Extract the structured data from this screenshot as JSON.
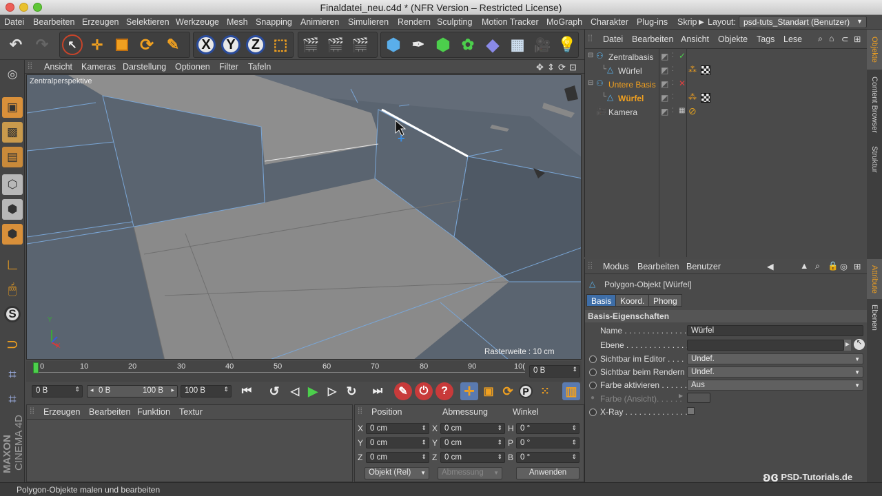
{
  "window": {
    "title": "Finaldatei_neu.c4d * (NFR Version – Restricted License)"
  },
  "menu": {
    "items": [
      "Datei",
      "Bearbeiten",
      "Erzeugen",
      "Selektieren",
      "Werkzeuge",
      "Mesh",
      "Snapping",
      "Animieren",
      "Simulieren",
      "Rendern",
      "Sculpting",
      "Motion Tracker",
      "MoGraph",
      "Charakter",
      "Plug-ins",
      "Skrip"
    ],
    "layout_label": "Layout:",
    "layout_value": "psd-tuts_Standart (Benutzer)"
  },
  "viewport": {
    "menu": [
      "Ansicht",
      "Kameras",
      "Darstellung",
      "Optionen",
      "Filter",
      "Tafeln"
    ],
    "perspective_label": "Zentralperspektive",
    "grid_info": "Rasterweite : 10 cm",
    "axis_y": "Y",
    "axis_x": "X"
  },
  "timeline": {
    "ticks": [
      "0",
      "10",
      "20",
      "30",
      "40",
      "50",
      "60",
      "70",
      "80",
      "90",
      "10("
    ],
    "current_frame": "0 B",
    "start_field": "0 B",
    "range_start": "0 B",
    "range_end": "100 B",
    "end_field": "100 B"
  },
  "material_panel": {
    "menu": [
      "Erzeugen",
      "Bearbeiten",
      "Funktion",
      "Textur"
    ]
  },
  "coord_panel": {
    "headers": [
      "Position",
      "Abmessung",
      "Winkel"
    ],
    "rows": [
      {
        "a": "X",
        "pos": "0 cm",
        "b": "X",
        "size": "0 cm",
        "c": "H",
        "rot": "0 °"
      },
      {
        "a": "Y",
        "pos": "0 cm",
        "b": "Y",
        "size": "0 cm",
        "c": "P",
        "rot": "0 °"
      },
      {
        "a": "Z",
        "pos": "0 cm",
        "b": "Z",
        "size": "0 cm",
        "c": "B",
        "rot": "0 °"
      }
    ],
    "mode": "Objekt (Rel)",
    "size_mode": "Abmessung",
    "apply": "Anwenden"
  },
  "objects_panel": {
    "menu": [
      "Datei",
      "Bearbeiten",
      "Ansicht",
      "Objekte",
      "Tags",
      "Lese"
    ],
    "tree": [
      {
        "name": "Zentralbasis",
        "level": 0,
        "highlight": false,
        "status": "check"
      },
      {
        "name": "Würfel",
        "level": 1,
        "highlight": false,
        "status": "dot"
      },
      {
        "name": "Untere Basis",
        "level": 0,
        "highlight": true,
        "status": "cross"
      },
      {
        "name": "Würfel",
        "level": 1,
        "highlight": true,
        "status": "dot"
      },
      {
        "name": "Kamera",
        "level": 0,
        "highlight": false,
        "status": "dot"
      }
    ]
  },
  "attr_panel": {
    "menu": [
      "Modus",
      "Bearbeiten",
      "Benutzer"
    ],
    "object_title": "Polygon-Objekt [Würfel]",
    "tabs": [
      "Basis",
      "Koord.",
      "Phong"
    ],
    "section": "Basis-Eigenschaften",
    "props": [
      {
        "label": "Name . . . . . . . . . . . . . . .",
        "value": "Würfel",
        "type": "text"
      },
      {
        "label": "Ebene . . . . . . . . . . . . . . .",
        "value": "",
        "type": "text"
      },
      {
        "label": "Sichtbar im Editor . . . .",
        "value": "Undef.",
        "type": "drop"
      },
      {
        "label": "Sichtbar beim Rendern",
        "value": "Undef.",
        "type": "drop"
      },
      {
        "label": "Farbe aktivieren . . . . . .",
        "value": "Aus",
        "type": "drop"
      },
      {
        "label": "Farbe (Ansicht). . . . . .",
        "value": "",
        "type": "color"
      },
      {
        "label": "X-Ray . . . . . . . . . . . . . . .",
        "value": "",
        "type": "check"
      }
    ]
  },
  "right_tabs": [
    "Objekte",
    "Content Browser",
    "Struktur",
    "Attribute",
    "Ebenen"
  ],
  "branding": {
    "maxon": "MAXON",
    "cinema": "CINEMA 4D",
    "watermark": "PSD-Tutorials.de"
  },
  "status": {
    "text": "Polygon-Objekte malen und bearbeiten"
  }
}
